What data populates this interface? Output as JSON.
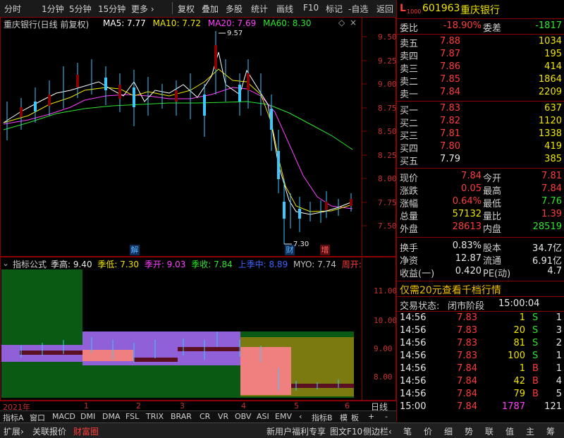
{
  "toolbar": {
    "items": [
      "分时",
      "1分钟",
      "5分钟",
      "15分钟",
      "更多 ›",
      "复权",
      "叠加",
      "多股",
      "统计",
      "画线",
      "F10",
      "标记",
      "-自选",
      "返回"
    ]
  },
  "main_chart": {
    "title": "重庆银行(日线 前复权)",
    "ma": [
      {
        "label": "MA5: 7.77",
        "color": "#ffffff"
      },
      {
        "label": "MA10: 7.72",
        "color": "#f0e600"
      },
      {
        "label": "MA20: 7.69",
        "color": "#ff40ff"
      },
      {
        "label": "MA60: 8.30",
        "color": "#2ee62e"
      }
    ],
    "y_ticks": [
      "9.50",
      "9.25",
      "9.00",
      "8.75",
      "8.50",
      "8.25",
      "8.00",
      "7.75",
      "7.50"
    ],
    "high_label": "9.57",
    "low_label": "7.30",
    "markers": [
      "解",
      "财",
      "增"
    ]
  },
  "indicator": {
    "title": "指标公式",
    "values": [
      {
        "label": "季高: 9.40",
        "color": "#e8e8e8"
      },
      {
        "label": "季低: 7.30",
        "color": "#f0e600"
      },
      {
        "label": "季开: 9.03",
        "color": "#ff40ff"
      },
      {
        "label": "季收: 7.84",
        "color": "#2ee62e"
      },
      {
        "label": "上季中: 8.89",
        "color": "#3c64ff"
      },
      {
        "label": "MYO: 7.74",
        "color": "#c0c0c0"
      },
      {
        "label": "周开: 7.75",
        "color": "#ff3c3c"
      },
      {
        "label": "上",
        "color": "#2ee62e"
      }
    ],
    "y_ticks": [
      "11.00",
      "10.00",
      "9.00",
      "8.00"
    ]
  },
  "x_axis": {
    "labels": [
      "2021年",
      "1",
      "2",
      "3",
      "4",
      "5",
      "6"
    ],
    "right_label": "日线"
  },
  "quote": {
    "code": "601963",
    "name": "重庆银行",
    "flag": "L",
    "flag_sub": "1000",
    "weibi_label": "委比",
    "weibi_value": "-18.90%",
    "weicha_label": "委差",
    "weicha_value": "-1817",
    "asks": [
      {
        "label": "卖五",
        "price": "7.88",
        "vol": "1034"
      },
      {
        "label": "卖四",
        "price": "7.87",
        "vol": "195"
      },
      {
        "label": "卖三",
        "price": "7.86",
        "vol": "414"
      },
      {
        "label": "卖二",
        "price": "7.85",
        "vol": "1864"
      },
      {
        "label": "卖一",
        "price": "7.84",
        "vol": "2209"
      }
    ],
    "bids": [
      {
        "label": "买一",
        "price": "7.83",
        "vol": "637"
      },
      {
        "label": "买二",
        "price": "7.82",
        "vol": "1120"
      },
      {
        "label": "买三",
        "price": "7.81",
        "vol": "1338"
      },
      {
        "label": "买四",
        "price": "7.80",
        "vol": "419"
      },
      {
        "label": "买五",
        "price": "7.79",
        "vol": "385"
      }
    ],
    "stats": [
      {
        "l1": "现价",
        "v1": "7.84",
        "c1": "#ff3c3c",
        "l2": "今开",
        "v2": "7.81",
        "c2": "#ff3c3c"
      },
      {
        "l1": "涨跌",
        "v1": "0.05",
        "c1": "#ff3c3c",
        "l2": "最高",
        "v2": "7.84",
        "c2": "#ff3c3c"
      },
      {
        "l1": "涨幅",
        "v1": "0.64%",
        "c1": "#ff3c3c",
        "l2": "最低",
        "v2": "7.76",
        "c2": "#2ee62e"
      },
      {
        "l1": "总量",
        "v1": "57132",
        "c1": "#f0e600",
        "l2": "量比",
        "v2": "1.39",
        "c2": "#ff3c3c"
      },
      {
        "l1": "外盘",
        "v1": "28613",
        "c1": "#ff3c3c",
        "l2": "内盘",
        "v2": "28519",
        "c2": "#2ee62e"
      }
    ],
    "stats2": [
      {
        "l1": "换手",
        "v1": "0.83%",
        "l2": "股本",
        "v2": "34.7亿"
      },
      {
        "l1": "净资",
        "v1": "12.87",
        "l2": "流通",
        "v2": "6.91亿"
      },
      {
        "l1": "收益(一)",
        "v1": "0.420",
        "l2": "PE(动)",
        "v2": "4.7"
      }
    ],
    "promo": "仅需20元查看千档行情",
    "status_label": "交易状态:",
    "status_value": "闭市阶段",
    "status_time": "15:00:04",
    "ticks": [
      {
        "t": "14:56",
        "p": "7.83",
        "v": "1",
        "s": "S",
        "n": "1"
      },
      {
        "t": "14:56",
        "p": "7.83",
        "v": "20",
        "s": "S",
        "n": "3"
      },
      {
        "t": "14:56",
        "p": "7.83",
        "v": "81",
        "s": "S",
        "n": "2"
      },
      {
        "t": "14:56",
        "p": "7.83",
        "v": "100",
        "s": "S",
        "n": "1"
      },
      {
        "t": "14:56",
        "p": "7.84",
        "v": "1",
        "s": "B",
        "n": "1"
      },
      {
        "t": "14:56",
        "p": "7.84",
        "v": "42",
        "s": "B",
        "n": "4"
      },
      {
        "t": "14:56",
        "p": "7.84",
        "v": "79",
        "s": "B",
        "n": "5"
      },
      {
        "t": "15:00",
        "p": "7.84",
        "v": "1787",
        "s": "",
        "n": "121"
      }
    ]
  },
  "tabs": [
    "指标A",
    "窗口",
    "MACD",
    "DMI",
    "DMA",
    "FSL",
    "TRIX",
    "BRAR",
    "CR",
    "VR",
    "OBV",
    "ASI",
    "EMV",
    "‹",
    "指标B",
    "模",
    "板",
    "+",
    "-"
  ],
  "bottom_left": [
    "扩展›",
    "关联报价",
    "财富圈"
  ],
  "bottom_mid": [
    "新用户福利专享",
    "图文F10",
    "侧边栏‹"
  ],
  "bottom_right": [
    "笔",
    "价",
    "细",
    "势",
    "联",
    "值",
    "主",
    "筹"
  ]
}
